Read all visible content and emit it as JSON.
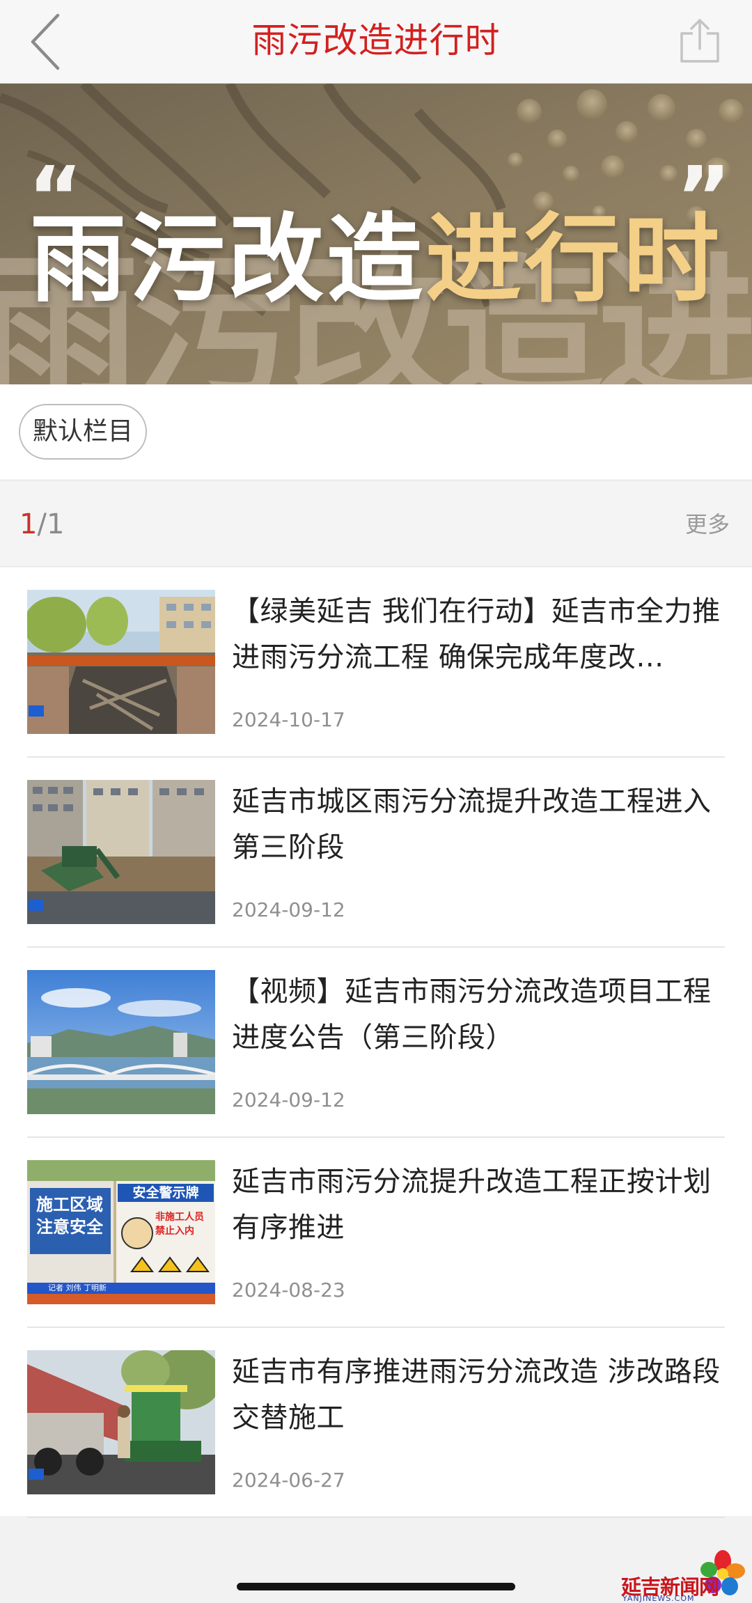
{
  "header": {
    "title": "雨污改造进行时"
  },
  "banner": {
    "title_white": "雨污改造",
    "title_gold": "进行时",
    "quote_open": "“",
    "quote_close": "”",
    "bg_text": "雨污改造进行时"
  },
  "category": {
    "chip_label": "默认栏目"
  },
  "pager": {
    "current": "1",
    "separator": "/",
    "total": "1",
    "more_label": "更多"
  },
  "list": [
    {
      "title": "【绿美延吉 我们在行动】延吉市全力推进雨污分流工程 确保完成年度改…",
      "date": "2024-10-17"
    },
    {
      "title": "延吉市城区雨污分流提升改造工程进入第三阶段",
      "date": "2024-09-12"
    },
    {
      "title": "【视频】延吉市雨污分流改造项目工程进度公告（第三阶段）",
      "date": "2024-09-12"
    },
    {
      "title": "延吉市雨污分流提升改造工程正按计划有序推进",
      "date": "2024-08-23"
    },
    {
      "title": "延吉市有序推进雨污分流改造 涉改路段交替施工",
      "date": "2024-06-27"
    }
  ],
  "thumb_text": {
    "sign_left": "施工区域注意安全",
    "sign_right": "安全警示牌",
    "sign_right_sub": "非施工人员禁止入内",
    "reporter": "记者 刘伟 丁明新"
  },
  "watermark": {
    "name": "延吉新闻网",
    "domain": "YANJINEWS.COM"
  },
  "colors": {
    "accent": "#d2201f",
    "banner_gold": "#f4cf88"
  }
}
